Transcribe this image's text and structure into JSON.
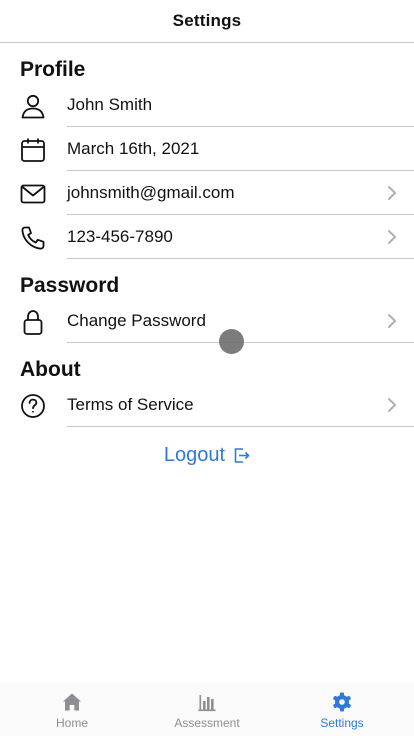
{
  "header": {
    "title": "Settings"
  },
  "sections": {
    "profile": {
      "title": "Profile",
      "items": [
        {
          "label": "John Smith",
          "icon": "user-icon"
        },
        {
          "label": "March 16th, 2021",
          "icon": "calendar-icon"
        },
        {
          "label": "johnsmith@gmail.com",
          "icon": "mail-icon"
        },
        {
          "label": "123-456-7890",
          "icon": "phone-icon"
        }
      ]
    },
    "password": {
      "title": "Password",
      "items": [
        {
          "label": "Change Password",
          "icon": "lock-icon"
        }
      ]
    },
    "about": {
      "title": "About",
      "items": [
        {
          "label": "Terms of Service",
          "icon": "help-circle-icon"
        }
      ]
    }
  },
  "logout": {
    "label": "Logout",
    "icon": "logout-icon"
  },
  "tabs": [
    {
      "label": "Home",
      "icon": "home-icon",
      "active": false
    },
    {
      "label": "Assessment",
      "icon": "bar-chart-icon",
      "active": false
    },
    {
      "label": "Settings",
      "icon": "gear-icon",
      "active": true
    }
  ],
  "colors": {
    "accent": "#2f7ad6",
    "divider": "#c8c8cc",
    "inactive_tab": "#8e8e93",
    "chevron": "#b0b0b5"
  }
}
